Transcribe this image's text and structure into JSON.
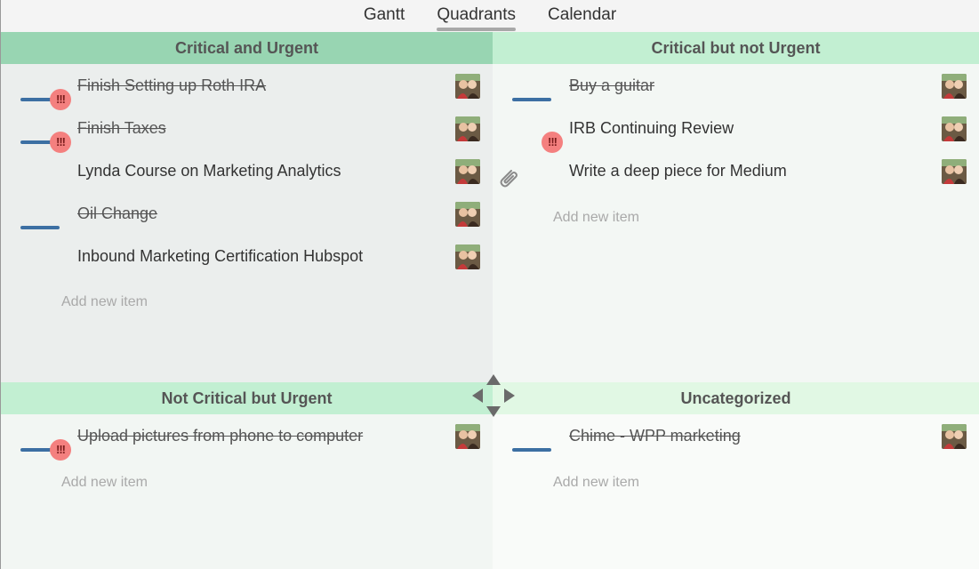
{
  "nav": {
    "tabs": [
      {
        "label": "Gantt"
      },
      {
        "label": "Quadrants"
      },
      {
        "label": "Calendar"
      }
    ],
    "active": "Quadrants"
  },
  "quadrants": {
    "q1": {
      "title": "Critical and Urgent",
      "items": [
        {
          "label": "Finish Setting up Roth IRA",
          "done": true,
          "alert": "!!!"
        },
        {
          "label": "Finish Taxes",
          "done": true,
          "alert": "!!!"
        },
        {
          "label": "Lynda Course on Marketing Analytics",
          "done": false
        },
        {
          "label": "Oil Change",
          "done": true
        },
        {
          "label": "Inbound Marketing Certification Hubspot",
          "done": false
        }
      ],
      "add_label": "Add new item"
    },
    "q2": {
      "title": "Critical but not Urgent",
      "items": [
        {
          "label": "Buy a guitar",
          "done": true
        },
        {
          "label": "IRB Continuing Review",
          "done": false,
          "alert": "!!!"
        },
        {
          "label": "Write a deep piece for Medium",
          "done": false
        }
      ],
      "add_label": "Add new item"
    },
    "q3": {
      "title": "Not Critical but Urgent",
      "items": [
        {
          "label": "Upload pictures from phone to computer",
          "done": true,
          "alert": "!!!"
        }
      ],
      "add_label": "Add new item"
    },
    "q4": {
      "title": "Uncategorized",
      "items": [
        {
          "label": "Chime - WPP marketing",
          "done": true
        }
      ],
      "add_label": "Add new item"
    }
  },
  "colors": {
    "accent_bar": "#3c6fa3",
    "alert": "#f4807f",
    "header_dark": "#98d5b2",
    "header_light": "#c2efd2"
  },
  "icons": {
    "attachment": "paperclip-icon",
    "move": "move-arrows-icon"
  }
}
